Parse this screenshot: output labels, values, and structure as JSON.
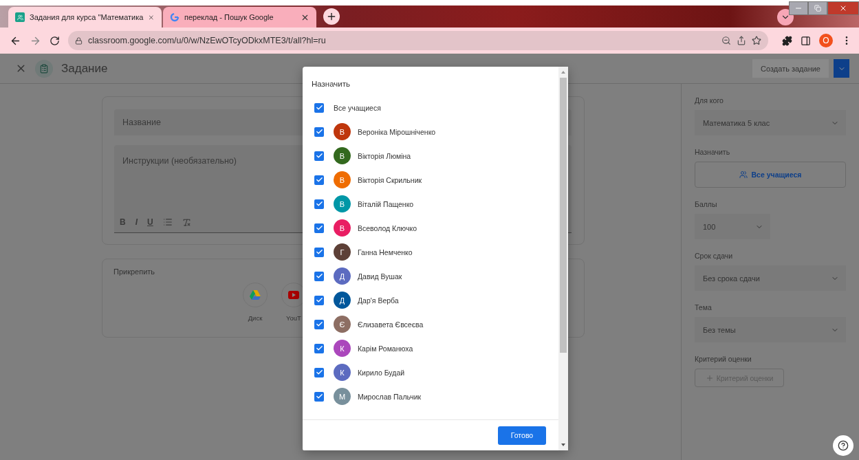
{
  "browser": {
    "tabs": [
      {
        "title": "Задания для курса \"Математика",
        "selected": true,
        "kind": "classroom"
      },
      {
        "title": "переклад - Пошук Google",
        "selected": false,
        "kind": "google"
      }
    ],
    "url": "classroom.google.com/u/0/w/NzEwOTcyODkxMTE3/t/all?hl=ru",
    "profile": "О"
  },
  "header": {
    "title": "Задание",
    "create_button": "Создать задание"
  },
  "form": {
    "title_placeholder": "Название",
    "instructions_placeholder": "Инструкции (необязательно)",
    "format_letters": [
      "B",
      "I",
      "U"
    ],
    "attach": {
      "label": "Прикрепить",
      "items": [
        {
          "kind": "drive",
          "label": "Диск"
        },
        {
          "kind": "youtube",
          "label": "YouT"
        }
      ]
    }
  },
  "sidebar": {
    "for_label": "Для кого",
    "for_value": "Математика 5 клас",
    "assign_label": "Назначить",
    "assign_value": "Все учащиеся",
    "points_label": "Баллы",
    "points_value": "100",
    "due_label": "Срок сдачи",
    "due_value": "Без срока сдачи",
    "topic_label": "Тема",
    "topic_value": "Без темы",
    "rubric_label": "Критерий оценки",
    "rubric_button": "Критерий оценки"
  },
  "dialog": {
    "title": "Назначить",
    "all": {
      "label": "Все учащиеся",
      "checked": true
    },
    "students": [
      {
        "initial": "В",
        "name": "Вероніка Мірошніченко",
        "color": "#bf360c",
        "checked": true
      },
      {
        "initial": "В",
        "name": "Вікторія Люміна",
        "color": "#33691e",
        "checked": true
      },
      {
        "initial": "В",
        "name": "Вікторія Скрильник",
        "color": "#ef6c00",
        "checked": true
      },
      {
        "initial": "В",
        "name": "Віталій Пащенко",
        "color": "#0097a7",
        "checked": true
      },
      {
        "initial": "В",
        "name": "Всеволод Ключко",
        "color": "#e91e63",
        "checked": true
      },
      {
        "initial": "Г",
        "name": "Ганна Немченко",
        "color": "#5d4037",
        "checked": true
      },
      {
        "initial": "Д",
        "name": "Давид Вушак",
        "color": "#5c6bc0",
        "checked": true
      },
      {
        "initial": "Д",
        "name": "Дар'я Верба",
        "color": "#01579b",
        "checked": true
      },
      {
        "initial": "Є",
        "name": "Єлизавета Євсеєва",
        "color": "#8d6e63",
        "checked": true
      },
      {
        "initial": "К",
        "name": "Карім Романюха",
        "color": "#ab47bc",
        "checked": true
      },
      {
        "initial": "К",
        "name": "Кирило Будай",
        "color": "#5c6bc0",
        "checked": true
      },
      {
        "initial": "М",
        "name": "Мирослав Пальчик",
        "color": "#78909c",
        "checked": true
      }
    ],
    "done_button": "Готово"
  }
}
